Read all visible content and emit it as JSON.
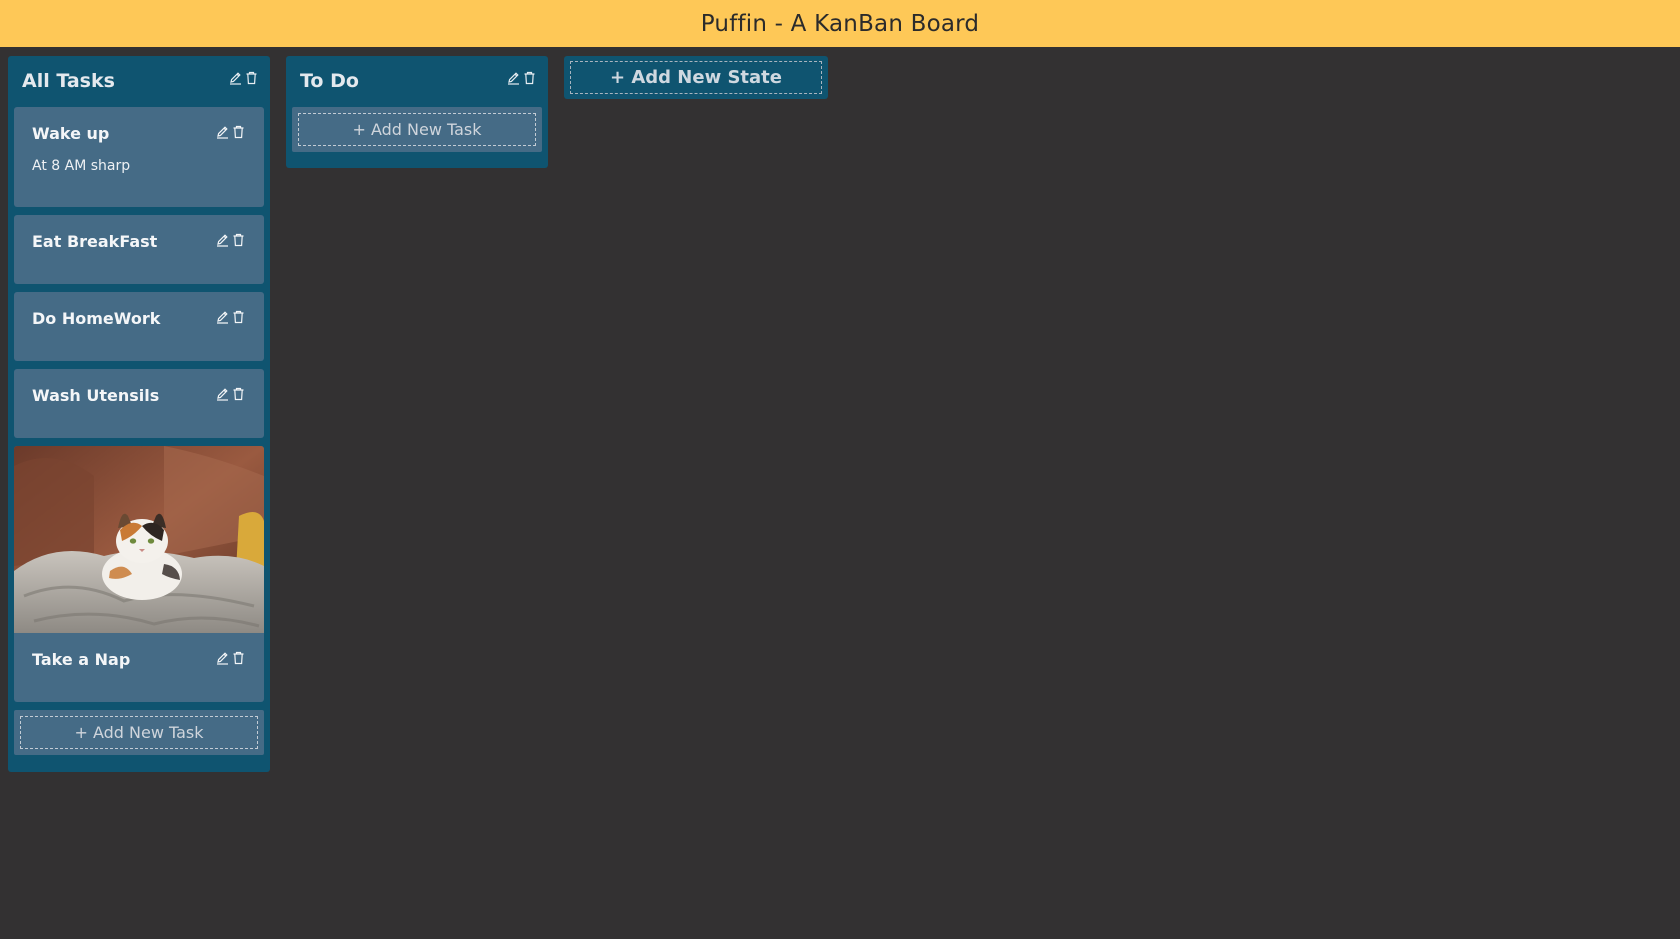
{
  "app": {
    "title": "Puffin - A KanBan Board"
  },
  "columns": [
    {
      "title": "All Tasks",
      "tasks": [
        {
          "title": "Wake up",
          "description": "At 8 AM sharp"
        },
        {
          "title": "Eat BreakFast"
        },
        {
          "title": "Do HomeWork"
        },
        {
          "title": "Wash Utensils"
        },
        {
          "title": "Take a Nap",
          "image": "cat-on-blanket-photo"
        }
      ],
      "add_task_label": "+ Add New Task"
    },
    {
      "title": "To Do",
      "tasks": [],
      "add_task_label": "+ Add New Task"
    }
  ],
  "add_state_label": "+ Add New State",
  "icons": {
    "edit": "pencil-icon",
    "delete": "trash-icon"
  },
  "colors": {
    "header": "#fec857",
    "background": "#333132",
    "column": "#0f5470",
    "card": "#456b86"
  }
}
